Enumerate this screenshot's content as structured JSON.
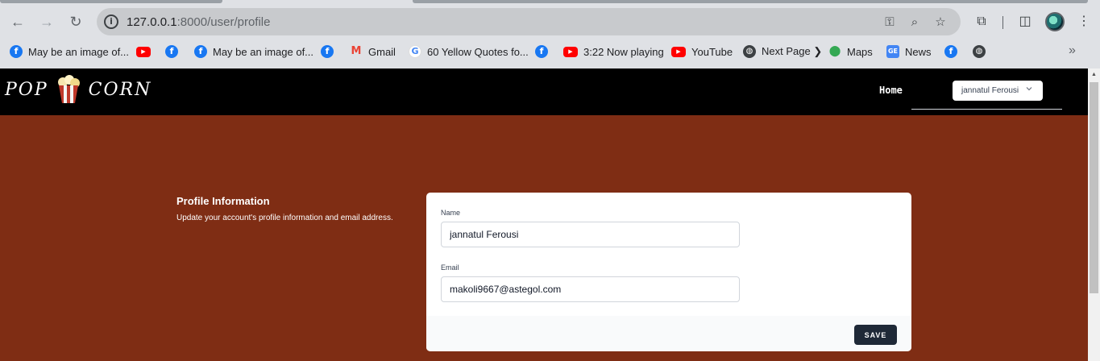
{
  "browser": {
    "url_host": "127.0.0.1",
    "url_path": ":8000/user/profile",
    "bookmarks": [
      {
        "label": "May be an image of...",
        "icon": "facebook-icon"
      },
      {
        "label": "",
        "icon": "youtube-icon"
      },
      {
        "label": "",
        "icon": "facebook-icon"
      },
      {
        "label": "May be an image of...",
        "icon": "facebook-icon"
      },
      {
        "label": "",
        "icon": "facebook-icon"
      },
      {
        "label": "Gmail",
        "icon": "gmail-icon"
      },
      {
        "label": "60 Yellow Quotes fo...",
        "icon": "google-icon"
      },
      {
        "label": "",
        "icon": "facebook-icon"
      },
      {
        "label": "3:22 Now playing",
        "icon": "youtube-icon"
      },
      {
        "label": "YouTube",
        "icon": "youtube-icon"
      },
      {
        "label": "Next Page ❯",
        "icon": "globe-icon"
      },
      {
        "label": "Maps",
        "icon": "maps-icon"
      },
      {
        "label": "News",
        "icon": "news-icon"
      },
      {
        "label": "",
        "icon": "facebook-icon"
      },
      {
        "label": "",
        "icon": "globe-icon"
      }
    ]
  },
  "site": {
    "logo_left": "POP",
    "logo_right": "CORN",
    "nav_home": "Home",
    "user_name": "jannatul Ferousi"
  },
  "profile": {
    "title": "Profile Information",
    "description": "Update your account's profile information and email address.",
    "name_label": "Name",
    "name_value": "jannatul Ferousi",
    "email_label": "Email",
    "email_value": "makoli9667@astegol.com",
    "save_label": "SAVE"
  },
  "colors": {
    "page_background": "#7f2d14",
    "header_background": "#000000",
    "save_button": "#1f2937"
  }
}
